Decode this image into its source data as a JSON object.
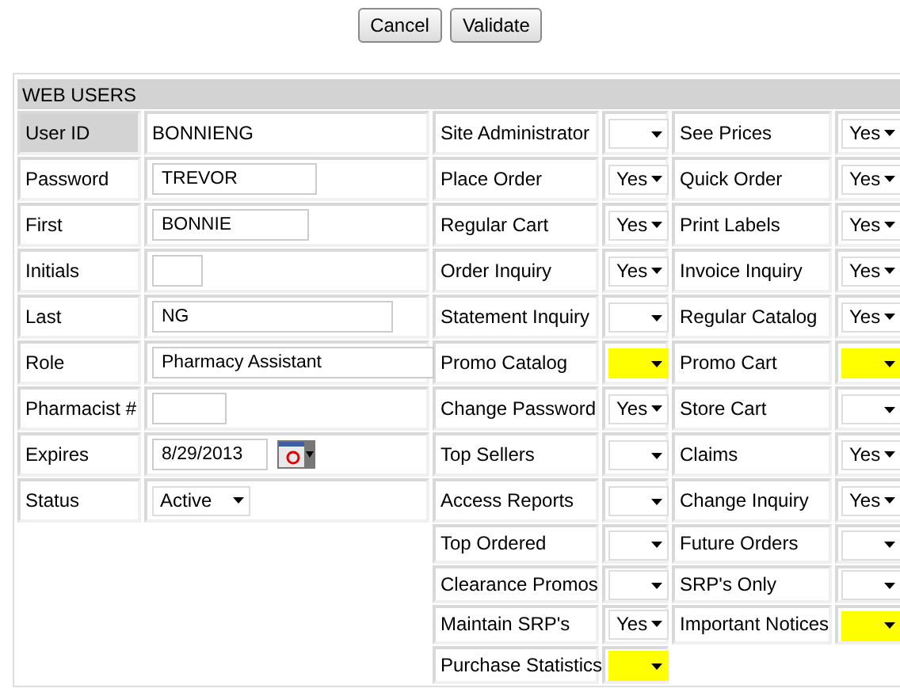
{
  "buttons": [
    "Cancel",
    "Validate"
  ],
  "section": {
    "title": "WEB USERS"
  },
  "user_fields": [
    {
      "label": "User ID",
      "kind": "static",
      "value": "BONNIENG"
    },
    {
      "label": "Password",
      "kind": "input",
      "value": "TREVOR"
    },
    {
      "label": "First",
      "kind": "input",
      "value": "BONNIE"
    },
    {
      "label": "Initials",
      "kind": "input"
    },
    {
      "label": "Last",
      "kind": "input",
      "value": "NG"
    },
    {
      "label": "Role",
      "kind": "input",
      "value": "Pharmacy Assistant"
    },
    {
      "label": "Pharmacist #",
      "kind": "input"
    },
    {
      "label": "Expires",
      "kind": "date",
      "value": "8/29/2013"
    },
    {
      "label": "Status",
      "kind": "select",
      "value": "Active"
    }
  ],
  "permissions": [
    [
      {
        "label": "Site Administrator",
        "highlighted": false
      },
      {
        "label": "See Prices",
        "value": "Yes",
        "highlighted": false
      }
    ],
    [
      {
        "label": "Place Order",
        "value": "Yes",
        "highlighted": false
      },
      {
        "label": "Quick Order",
        "value": "Yes",
        "highlighted": false
      }
    ],
    [
      {
        "label": "Regular Cart",
        "value": "Yes",
        "highlighted": false
      },
      {
        "label": "Print Labels",
        "value": "Yes",
        "highlighted": false
      }
    ],
    [
      {
        "label": "Order Inquiry",
        "value": "Yes",
        "highlighted": false
      },
      {
        "label": "Invoice Inquiry",
        "value": "Yes",
        "highlighted": false
      }
    ],
    [
      {
        "label": "Statement Inquiry",
        "highlighted": false
      },
      {
        "label": "Regular Catalog",
        "value": "Yes",
        "highlighted": false
      }
    ],
    [
      {
        "label": "Promo Catalog",
        "highlighted": true
      },
      {
        "label": "Promo Cart",
        "highlighted": true
      }
    ],
    [
      {
        "label": "Change Password",
        "value": "Yes",
        "highlighted": false
      },
      {
        "label": "Store Cart",
        "highlighted": false
      }
    ],
    [
      {
        "label": "Top Sellers",
        "highlighted": false
      },
      {
        "label": "Claims",
        "value": "Yes",
        "highlighted": false
      }
    ],
    [
      {
        "label": "Access Reports",
        "highlighted": false
      },
      {
        "label": "Change Inquiry",
        "value": "Yes",
        "highlighted": false
      }
    ],
    [
      {
        "label": "Top Ordered",
        "highlighted": false
      },
      {
        "label": "Future Orders",
        "highlighted": false
      }
    ],
    [
      {
        "label": "Clearance Promos",
        "highlighted": false
      },
      {
        "label": "SRP's Only",
        "highlighted": false
      }
    ],
    [
      {
        "label": "Maintain SRP's",
        "value": "Yes",
        "highlighted": false
      },
      {
        "label": "Important Notices",
        "highlighted": true
      }
    ],
    [
      {
        "label": "Purchase Statistics",
        "highlighted": true
      }
    ]
  ]
}
